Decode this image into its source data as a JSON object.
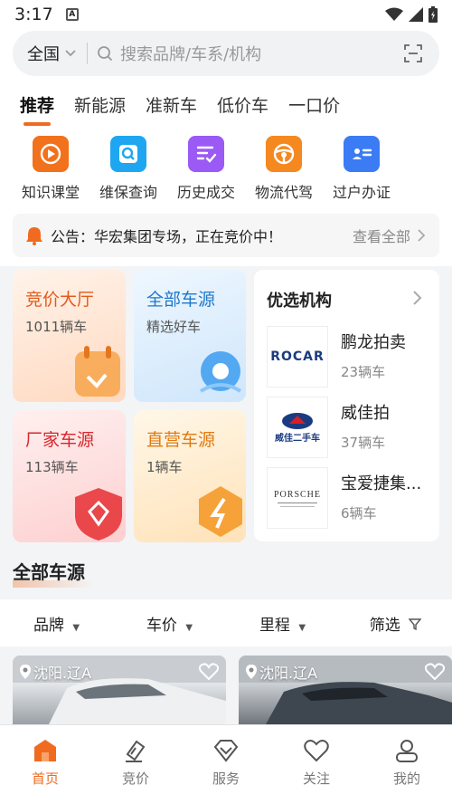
{
  "status": {
    "time": "3:17"
  },
  "search": {
    "region": "全国",
    "placeholder": "搜索品牌/车系/机构"
  },
  "tabs": [
    {
      "label": "推荐",
      "active": true
    },
    {
      "label": "新能源"
    },
    {
      "label": "准新车"
    },
    {
      "label": "低价车"
    },
    {
      "label": "一口价"
    }
  ],
  "quick": [
    {
      "label": "知识课堂",
      "icon": "play-icon",
      "color": "#f2711c"
    },
    {
      "label": "维保查询",
      "icon": "magnify-icon",
      "color": "#1ea7f0"
    },
    {
      "label": "历史成交",
      "icon": "checklist-icon",
      "color": "#9b59f5"
    },
    {
      "label": "物流代驾",
      "icon": "steering-wheel-icon",
      "color": "#f5881e"
    },
    {
      "label": "过户办证",
      "icon": "id-card-icon",
      "color": "#3b7cf5"
    }
  ],
  "notice": {
    "label": "公告：",
    "text": "华宏集团专场，正在竞价中！",
    "more": "查看全部"
  },
  "cards": {
    "auction": {
      "title": "竞价大厅",
      "sub": "1011辆车"
    },
    "all": {
      "title": "全部车源",
      "sub": "精选好车"
    },
    "factory": {
      "title": "厂家车源",
      "sub": "113辆车"
    },
    "direct": {
      "title": "直营车源",
      "sub": "1辆车"
    }
  },
  "promo": {
    "title": "优选机构",
    "orgs": [
      {
        "name": "鹏龙拍卖",
        "count": "23辆车",
        "logo": "ROCAR"
      },
      {
        "name": "威佳拍",
        "count": "37辆车",
        "logo": "威佳二手车"
      },
      {
        "name": "宝爱捷集...",
        "count": "6辆车",
        "logo": "PORSCHE"
      }
    ]
  },
  "section": {
    "title": "全部车源"
  },
  "filters": [
    {
      "label": "品牌"
    },
    {
      "label": "车价"
    },
    {
      "label": "里程"
    },
    {
      "label": "筛选"
    }
  ],
  "listings": [
    {
      "location": "沈阳.辽A"
    },
    {
      "location": "沈阳.辽A"
    }
  ],
  "bottom_nav": [
    {
      "label": "首页",
      "active": true
    },
    {
      "label": "竞价"
    },
    {
      "label": "服务"
    },
    {
      "label": "关注"
    },
    {
      "label": "我的"
    }
  ],
  "colors": {
    "accent": "#f06b20"
  }
}
